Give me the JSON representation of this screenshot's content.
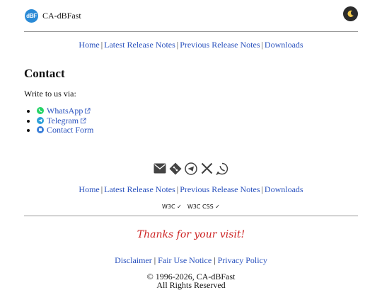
{
  "header": {
    "logo_text": "dBF",
    "site_name": "CA-dBFast",
    "theme_icon": "moon-icon"
  },
  "nav": {
    "items": [
      "Home",
      "Latest Release Notes",
      "Previous Release Notes",
      "Downloads"
    ],
    "separator": "|"
  },
  "main": {
    "title": "Contact",
    "intro": "Write to us via:",
    "contacts": [
      {
        "label": "WhatsApp",
        "icon": "whatsapp-icon",
        "color": "#25d366",
        "external": true
      },
      {
        "label": "Telegram",
        "icon": "telegram-icon",
        "color": "#2a9fd8",
        "external": true
      },
      {
        "label": "Contact Form",
        "icon": "contact-form-icon",
        "color": "#3b7fd9",
        "external": false
      }
    ]
  },
  "footer": {
    "social_icons": [
      "mail-icon",
      "git-icon",
      "telegram-icon",
      "x-icon",
      "whatsapp-icon"
    ],
    "badges": [
      "W3C ✓",
      "W3C CSS ✓"
    ],
    "thanks": "Thanks for your visit!",
    "legal_links": [
      "Disclaimer",
      "Fair Use Notice",
      "Privacy Policy"
    ],
    "copyright": "© 1996-2026, CA-dBFast",
    "rights": "All Rights Reserved"
  },
  "colors": {
    "link": "#2a52be",
    "accent_red": "#cc2222"
  }
}
